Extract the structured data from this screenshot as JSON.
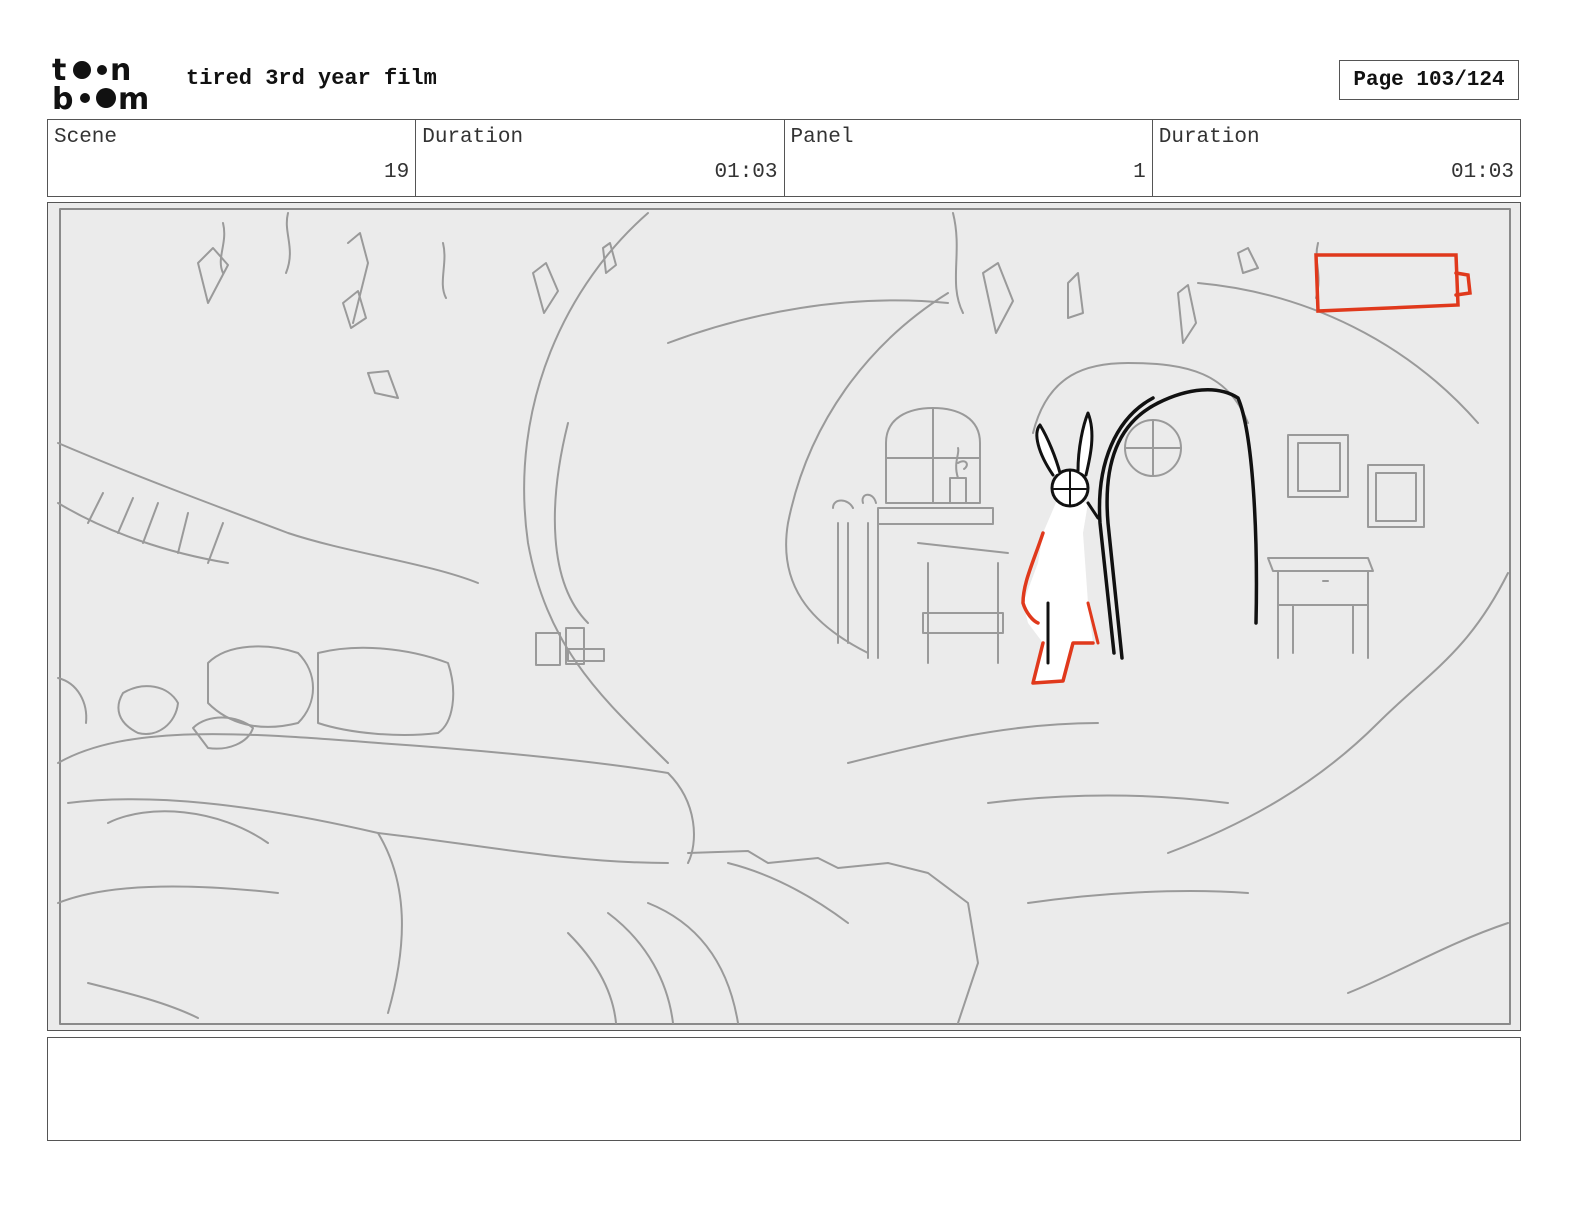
{
  "header": {
    "logo": "toon boom",
    "project_title": "tired 3rd year film",
    "page_label": "Page 103/124"
  },
  "info": {
    "scene_label": "Scene",
    "scene_value": "19",
    "scene_duration_label": "Duration",
    "scene_duration_value": "01:03",
    "panel_label": "Panel",
    "panel_value": "1",
    "panel_duration_label": "Duration",
    "panel_duration_value": "01:03"
  },
  "colors": {
    "sketch_gray": "#9a9a9a",
    "accent_red": "#e0391c",
    "ink_black": "#111111",
    "panel_bg": "#ebebeb"
  }
}
